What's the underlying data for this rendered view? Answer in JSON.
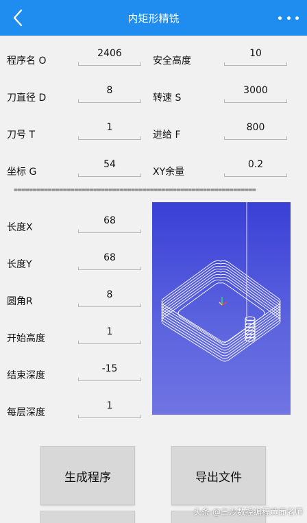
{
  "appbar": {
    "title": "内矩形精铣",
    "back_icon": "back-arrow-icon",
    "more_icon": "more-dots-icon",
    "color": "#1f8cf0"
  },
  "params_top": [
    {
      "label": "程序名 O",
      "value": "2406"
    },
    {
      "label": "安全高度",
      "value": "10"
    },
    {
      "label": "刀直径 D",
      "value": "8"
    },
    {
      "label": "转速 S",
      "value": "3000"
    },
    {
      "label": "刀号 T",
      "value": "1"
    },
    {
      "label": "进给 F",
      "value": "800"
    },
    {
      "label": "坐标 G",
      "value": "54"
    },
    {
      "label": "XY余量",
      "value": "0.2"
    }
  ],
  "separator": "================================================================",
  "params_left": [
    {
      "label": "长度X",
      "value": "68"
    },
    {
      "label": "长度Y",
      "value": "68"
    },
    {
      "label": "圆角R",
      "value": "8"
    },
    {
      "label": "开始高度",
      "value": "1"
    },
    {
      "label": "结束深度",
      "value": "-15"
    },
    {
      "label": "每层深度",
      "value": "1"
    }
  ],
  "buttons": {
    "generate": "生成程序",
    "export": "导出文件"
  },
  "watermark": "头条 @三沙数控编程黄面老师",
  "preview": {
    "background_top": "#3a3fd6",
    "background_bottom": "#7074e2"
  }
}
